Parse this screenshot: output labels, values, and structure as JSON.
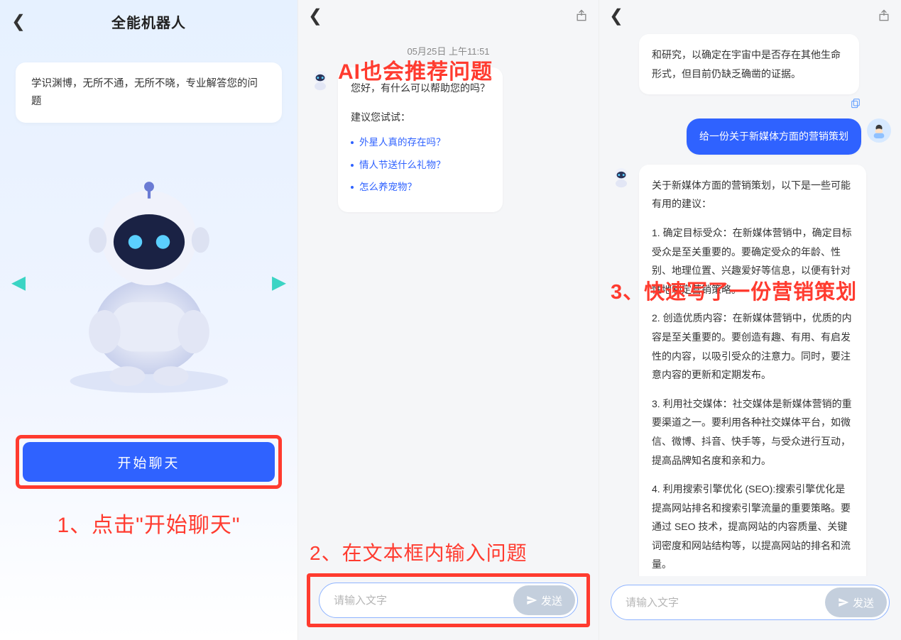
{
  "panel1": {
    "title": "全能机器人",
    "intro": "学识渊博，无所不通，无所不晓，专业解答您的问题",
    "start_btn": "开始聊天",
    "annotation": "1、点击\"开始聊天\""
  },
  "panel2": {
    "annotation_top": "AI也会推荐问题",
    "timestamp": "05月25日  上午11:51",
    "greeting": "您好，有什么可以帮助您的吗？",
    "suggest_header": "建议您试试：",
    "suggestions": [
      "外星人真的存在吗？",
      "情人节送什么礼物？",
      "怎么养宠物？"
    ],
    "annotation_bottom": "2、在文本框内输入问题",
    "placeholder": "请输入文字",
    "send_label": "发送"
  },
  "panel3": {
    "annotation": "3、快速写了一份营销策划",
    "partial_reply_top": "和研究，以确定在宇宙中是否存在其他生命形式，但目前仍缺乏确凿的证据。",
    "user_msg": "给一份关于新媒体方面的营销策划",
    "reply": {
      "intro": "关于新媒体方面的营销策划，以下是一些可能有用的建议：",
      "p1": "1. 确定目标受众：在新媒体营销中，确定目标受众是至关重要的。要确定受众的年龄、性别、地理位置、兴趣爱好等信息，以便有针对性地制定营销策略。",
      "p2": "2. 创造优质内容：在新媒体营销中，优质的内容是至关重要的。要创造有趣、有用、有启发性的内容，以吸引受众的注意力。同时，要注意内容的更新和定期发布。",
      "p3": "3. 利用社交媒体：社交媒体是新媒体营销的重要渠道之一。要利用各种社交媒体平台，如微信、微博、抖音、快手等，与受众进行互动，提高品牌知名度和亲和力。",
      "p4": "4. 利用搜索引擎优化 (SEO):搜索引擎优化是提高网站排名和搜索引擎流量的重要策略。要通过 SEO 技术，提高网站的内容质量、关键词密度和网站结构等，以提高网站的排名和流量。"
    },
    "placeholder": "请输入文字",
    "send_label": "发送"
  }
}
